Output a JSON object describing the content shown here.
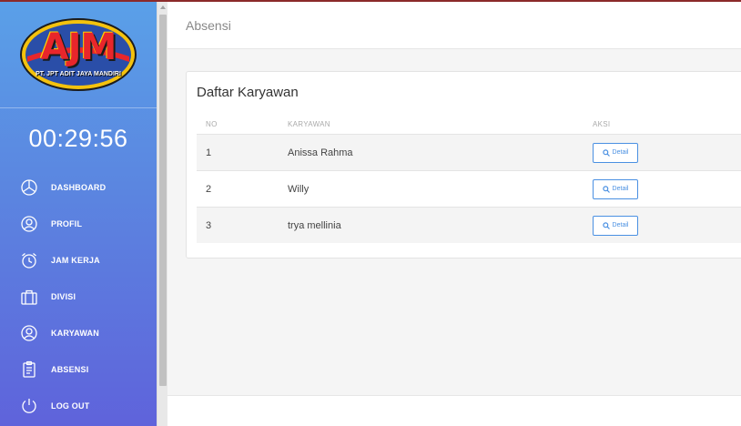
{
  "colors": {
    "sidebar_top": "#5aa0e8",
    "sidebar_bottom": "#5f63db",
    "accent": "#4a90e2",
    "logo_red": "#e8262b",
    "logo_oval": "#2a4ea8"
  },
  "sidebar": {
    "logo_text": "AJM",
    "logo_subtitle": "PT. JPT ADIT JAYA MANDIRI",
    "clock": "00:29:56",
    "items": [
      {
        "label": "DASHBOARD",
        "icon": "pie-chart-icon"
      },
      {
        "label": "PROFIL",
        "icon": "user-circle-icon"
      },
      {
        "label": "JAM KERJA",
        "icon": "alarm-clock-icon"
      },
      {
        "label": "DIVISI",
        "icon": "briefcase-icon"
      },
      {
        "label": "KARYAWAN",
        "icon": "user-circle-icon"
      },
      {
        "label": "ABSENSI",
        "icon": "clipboard-icon"
      },
      {
        "label": "LOG OUT",
        "icon": "power-icon"
      }
    ]
  },
  "header": {
    "title": "Absensi"
  },
  "card": {
    "title": "Daftar Karyawan",
    "columns": [
      "NO",
      "KARYAWAN",
      "AKSI"
    ],
    "rows": [
      {
        "no": "1",
        "name": "Anissa Rahma",
        "action": "Detail"
      },
      {
        "no": "2",
        "name": "Willy",
        "action": "Detail"
      },
      {
        "no": "3",
        "name": "trya mellinia",
        "action": "Detail"
      }
    ]
  }
}
